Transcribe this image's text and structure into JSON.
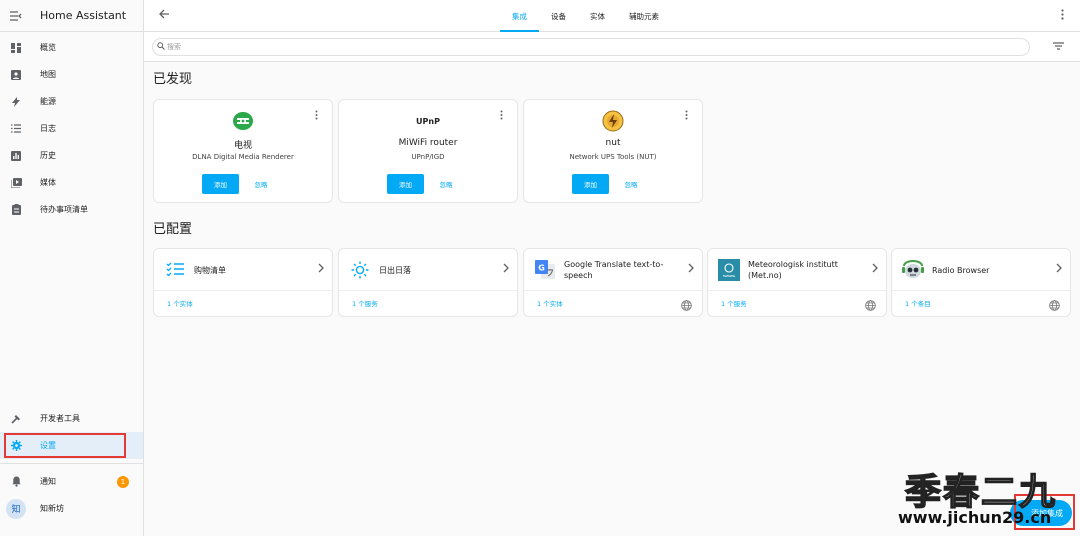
{
  "app": {
    "title": "Home Assistant"
  },
  "sidebar": {
    "items": [
      {
        "label": "概览",
        "icon": "dashboard-icon"
      },
      {
        "label": "地图",
        "icon": "map-icon"
      },
      {
        "label": "能源",
        "icon": "lightning-icon"
      },
      {
        "label": "日志",
        "icon": "list-icon"
      },
      {
        "label": "历史",
        "icon": "chart-icon"
      },
      {
        "label": "媒体",
        "icon": "media-icon"
      },
      {
        "label": "待办事项清单",
        "icon": "clipboard-icon"
      }
    ],
    "developer_tools": "开发者工具",
    "settings": "设置",
    "notifications": "通知",
    "notification_count": "1",
    "user_avatar": "知",
    "user_name": "知新坊"
  },
  "tabs": [
    {
      "label": "集成",
      "active": true
    },
    {
      "label": "设备",
      "active": false
    },
    {
      "label": "实体",
      "active": false
    },
    {
      "label": "辅助元素",
      "active": false
    }
  ],
  "search": {
    "placeholder": "搜索"
  },
  "discovered": {
    "title": "已发现",
    "add_label": "添加",
    "ignore_label": "忽略",
    "cards": [
      {
        "name": "电视",
        "sub": "DLNA Digital Media Renderer",
        "logo": "dlna-logo"
      },
      {
        "name": "MiWiFi router",
        "sub": "UPnP/IGD",
        "logo": "UPnP"
      },
      {
        "name": "nut",
        "sub": "Network UPS Tools (NUT)",
        "logo": "nut-logo"
      }
    ]
  },
  "configured": {
    "title": "已配置",
    "cards": [
      {
        "name": "购物清单",
        "count": "1 个实体",
        "icon": "shopping-list-icon"
      },
      {
        "name": "日出日落",
        "count": "1 个服务",
        "icon": "sun-icon"
      },
      {
        "name": "Google Translate text-to-speech",
        "count": "1 个实体",
        "icon": "google-translate-icon"
      },
      {
        "name": "Meteorologisk institutt (Met.no)",
        "count": "1 个服务",
        "icon": "met-no-icon"
      },
      {
        "name": "Radio Browser",
        "count": "1 个条目",
        "icon": "radio-browser-icon"
      }
    ]
  },
  "fab": {
    "label": "添加集成"
  },
  "watermark": {
    "line1": "季春二九",
    "line2": "www.jichun29.cn"
  },
  "colors": {
    "primary": "#03a9f4",
    "highlight": "#e53935",
    "badge": "#ff9800"
  }
}
